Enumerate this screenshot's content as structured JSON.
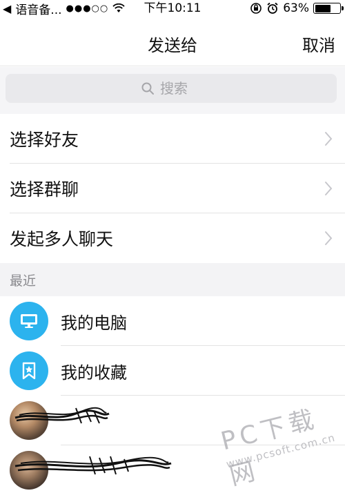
{
  "status_bar": {
    "back_label": "语音备...",
    "signal": "●●●○○",
    "time": "下午10:11",
    "battery_text": "63%",
    "battery_level": 0.63
  },
  "nav": {
    "title": "发送给",
    "cancel_label": "取消"
  },
  "search": {
    "placeholder": "搜索"
  },
  "menu": {
    "items": [
      {
        "label": "选择好友"
      },
      {
        "label": "选择群聊"
      },
      {
        "label": "发起多人聊天"
      }
    ]
  },
  "recent": {
    "header": "最近",
    "items": [
      {
        "name": "我的电脑",
        "icon": "computer-icon"
      },
      {
        "name": "我的收藏",
        "icon": "bookmark-star-icon"
      },
      {
        "name": "",
        "icon": "contact-avatar"
      },
      {
        "name": "",
        "icon": "contact-avatar"
      }
    ]
  },
  "watermark": {
    "main": "PC下载网",
    "url": "www.pcsoft.com.cn"
  },
  "colors": {
    "accent_blue": "#2CB3EE",
    "chevron": "#C7C7CC",
    "section_bg": "#F3F3F5"
  }
}
